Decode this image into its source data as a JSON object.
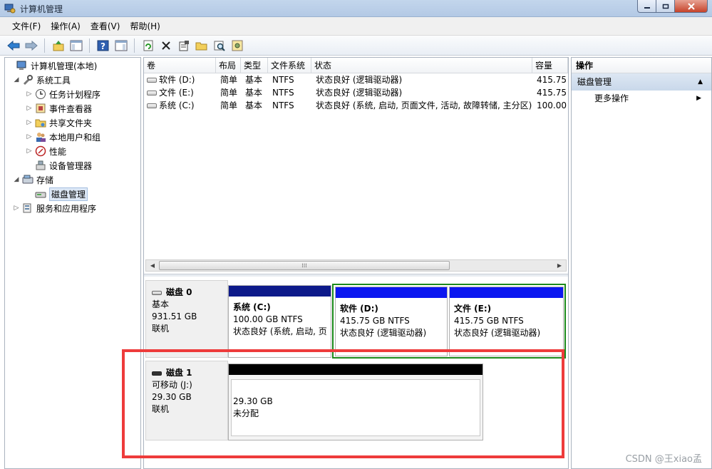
{
  "window": {
    "title": "计算机管理"
  },
  "menu": [
    {
      "label": "文件(F)"
    },
    {
      "label": "操作(A)"
    },
    {
      "label": "查看(V)"
    },
    {
      "label": "帮助(H)"
    }
  ],
  "toolbar_icons": [
    "back-icon",
    "forward-icon",
    "up-icon",
    "show-tree-icon",
    "help-icon",
    "show-action-pane-icon",
    "refresh-icon",
    "delete-icon",
    "properties-icon",
    "open-icon",
    "search-icon",
    "settings-icon"
  ],
  "tree": [
    {
      "label": "计算机管理(本地)",
      "icon": "computer-icon",
      "expander": "",
      "level": 0
    },
    {
      "label": "系统工具",
      "icon": "tools-icon",
      "expander": "◢",
      "level": 1
    },
    {
      "label": "任务计划程序",
      "icon": "clock-icon",
      "expander": "▷",
      "level": 2
    },
    {
      "label": "事件查看器",
      "icon": "event-viewer-icon",
      "expander": "▷",
      "level": 2
    },
    {
      "label": "共享文件夹",
      "icon": "shared-folder-icon",
      "expander": "▷",
      "level": 2
    },
    {
      "label": "本地用户和组",
      "icon": "users-icon",
      "expander": "▷",
      "level": 2
    },
    {
      "label": "性能",
      "icon": "performance-icon",
      "expander": "▷",
      "level": 2
    },
    {
      "label": "设备管理器",
      "icon": "device-manager-icon",
      "expander": "",
      "level": 2
    },
    {
      "label": "存储",
      "icon": "storage-icon",
      "expander": "◢",
      "level": 1
    },
    {
      "label": "磁盘管理",
      "icon": "disk-management-icon",
      "expander": "",
      "level": 2,
      "selected": true
    },
    {
      "label": "服务和应用程序",
      "icon": "services-icon",
      "expander": "▷",
      "level": 1
    }
  ],
  "volume_list": {
    "headers": [
      "卷",
      "布局",
      "类型",
      "文件系统",
      "状态",
      "容量"
    ],
    "rows": [
      [
        "软件 (D:)",
        "简单",
        "基本",
        "NTFS",
        "状态良好 (逻辑驱动器)",
        "415.75 ("
      ],
      [
        "文件 (E:)",
        "简单",
        "基本",
        "NTFS",
        "状态良好 (逻辑驱动器)",
        "415.75 ("
      ],
      [
        "系统 (C:)",
        "简单",
        "基本",
        "NTFS",
        "状态良好 (系统, 启动, 页面文件, 活动, 故障转储, 主分区)",
        "100.00 ("
      ]
    ]
  },
  "disks": [
    {
      "name": "磁盘 0",
      "type": "基本",
      "size": "931.51 GB",
      "status": "联机",
      "partitions": [
        {
          "name": "系统  (C:)",
          "size": "100.00 GB NTFS",
          "status": "状态良好 (系统, 启动, 页"
        },
        {
          "name": "软件   (D:)",
          "size": "415.75 GB NTFS",
          "status": "状态良好 (逻辑驱动器)"
        },
        {
          "name": "文件   (E:)",
          "size": "415.75 GB NTFS",
          "status": "状态良好 (逻辑驱动器)"
        }
      ]
    },
    {
      "name": "磁盘 1",
      "type": "可移动 (J:)",
      "size": "29.30 GB",
      "status": "联机",
      "partitions": [
        {
          "size": "29.30 GB",
          "status": "未分配"
        }
      ]
    }
  ],
  "actions": {
    "header": "操作",
    "section": "磁盘管理",
    "items": [
      "更多操作"
    ]
  },
  "colors": {
    "primary_partition": "#0d1a8a",
    "logical_drive": "#0b17f0",
    "unallocated": "#000000",
    "extended_partition": "#1b8a1b",
    "highlight": "#ee3b3b"
  },
  "watermark": "CSDN @王xiao孟"
}
